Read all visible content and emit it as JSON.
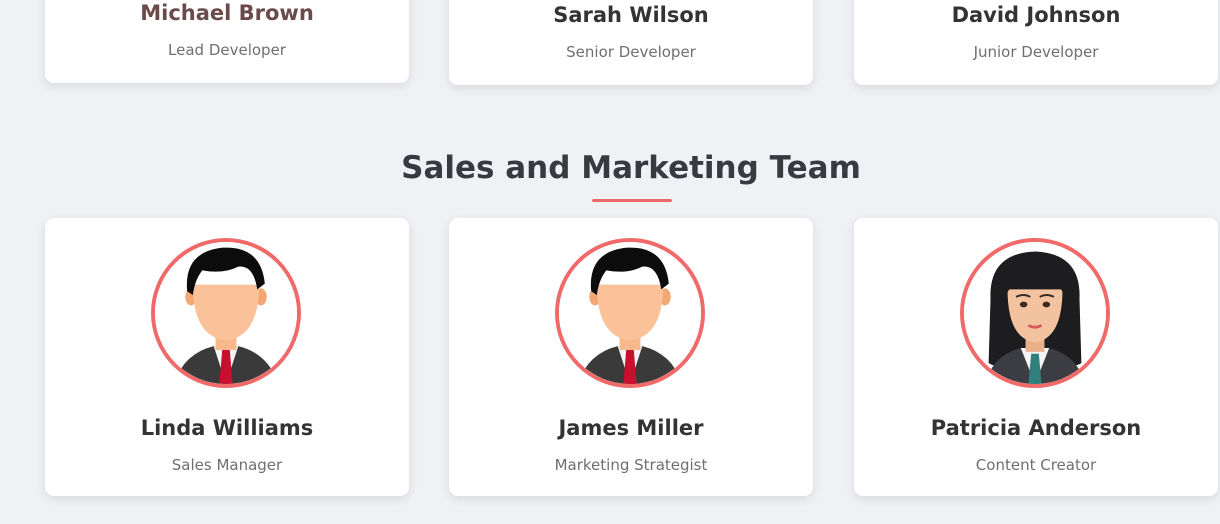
{
  "top_row": [
    {
      "name": "Michael Brown",
      "role": "Lead Developer"
    },
    {
      "name": "Sarah Wilson",
      "role": "Senior Developer"
    },
    {
      "name": "David Johnson",
      "role": "Junior Developer"
    }
  ],
  "section": {
    "title": "Sales and Marketing Team"
  },
  "team": [
    {
      "name": "Linda Williams",
      "role": "Sales Manager",
      "avatar": "male-avatar-icon"
    },
    {
      "name": "James Miller",
      "role": "Marketing Strategist",
      "avatar": "male-avatar-icon"
    },
    {
      "name": "Patricia Anderson",
      "role": "Content Creator",
      "avatar": "female-avatar-icon"
    }
  ],
  "colors": {
    "accent": "#f06a6a",
    "background": "#f0f1f5",
    "card": "#ffffff"
  }
}
